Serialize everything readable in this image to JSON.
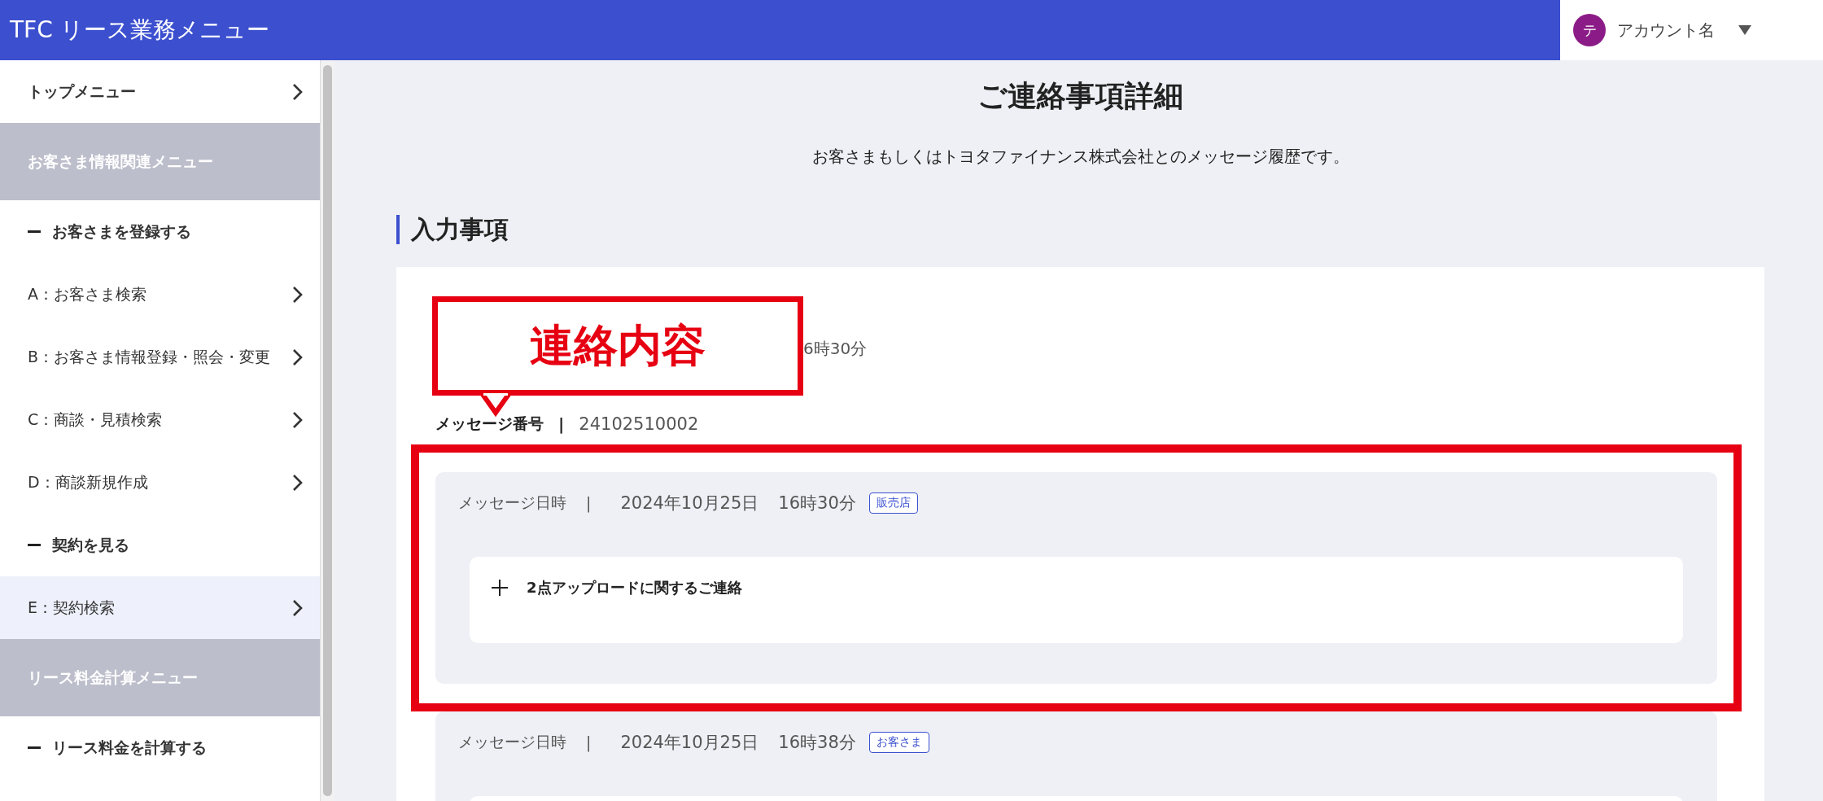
{
  "header": {
    "title": "TFC リース業務メニュー",
    "account": {
      "avatar": "テ",
      "name": "アカウント名"
    }
  },
  "sidebar": {
    "items": [
      {
        "kind": "link",
        "label": "トップメニュー",
        "selected": false
      },
      {
        "kind": "section",
        "label": "お客さま情報関連メニュー"
      },
      {
        "kind": "group",
        "label": "お客さまを登録する"
      },
      {
        "kind": "link",
        "label": "A：お客さま検索",
        "selected": false
      },
      {
        "kind": "link",
        "label": "B：お客さま情報登録・照会・変更",
        "selected": false
      },
      {
        "kind": "link",
        "label": "C：商談・見積検索",
        "selected": false
      },
      {
        "kind": "link",
        "label": "D：商談新規作成",
        "selected": false
      },
      {
        "kind": "group",
        "label": "契約を見る"
      },
      {
        "kind": "link",
        "label": "E：契約検索",
        "selected": true
      },
      {
        "kind": "section",
        "label": "リース料金計算メニュー"
      },
      {
        "kind": "group",
        "label": "リース料金を計算する"
      }
    ]
  },
  "page": {
    "title": "ご連絡事項詳細",
    "subtitle": "お客さまもしくはトヨタファイナンス株式会社とのメッセージ履歴です。",
    "section_heading": "入力事項"
  },
  "callout": {
    "text": "連絡内容",
    "covered_text_tail": "6時30分"
  },
  "message_number": {
    "label": "メッセージ番号",
    "separator": "|",
    "value": "24102510002"
  },
  "messages": [
    {
      "label": "メッセージ日時",
      "separator": "|",
      "date": "2024年10月25日",
      "time": "16時30分",
      "sender": "販売店",
      "subject": "2点アップロードに関するご連絡",
      "highlighted": true
    },
    {
      "label": "メッセージ日時",
      "separator": "|",
      "date": "2024年10月25日",
      "time": "16時38分",
      "sender": "お客さま",
      "highlighted": false
    }
  ]
}
